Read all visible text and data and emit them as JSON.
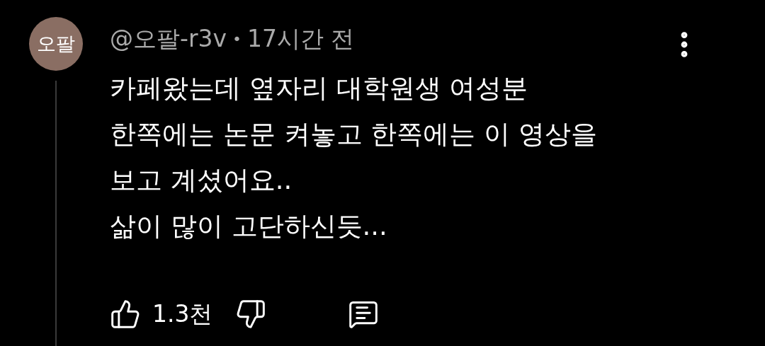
{
  "comment": {
    "avatar_text": "오팔",
    "author": "@오팔-r3v",
    "separator": "•",
    "time": "17시간 전",
    "lines": [
      "카페왔는데 옆자리 대학원생 여성분",
      "한쪽에는 논문 켜놓고 한쪽에는 이 영상을",
      "보고 계셨어요..",
      "삶이 많이 고단하신듯..."
    ],
    "likes": "1.3천"
  }
}
